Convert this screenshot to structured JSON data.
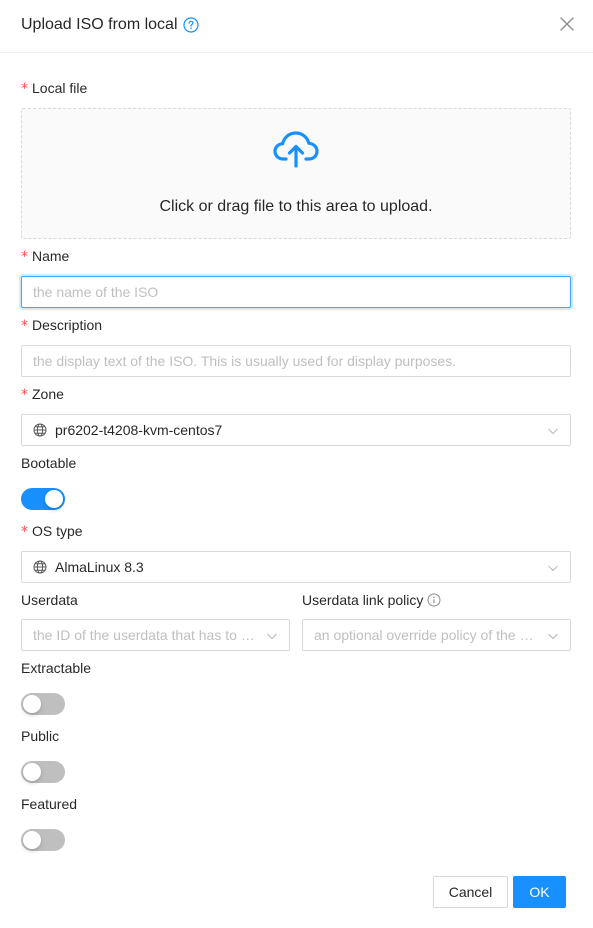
{
  "dialog": {
    "title": "Upload ISO from local"
  },
  "form": {
    "local_file": {
      "label": "Local file",
      "dropzone_text": "Click or drag file to this area to upload."
    },
    "name": {
      "label": "Name",
      "placeholder": "the name of the ISO",
      "value": ""
    },
    "description": {
      "label": "Description",
      "placeholder": "the display text of the ISO. This is usually used for display purposes.",
      "value": ""
    },
    "zone": {
      "label": "Zone",
      "value": "pr6202-t4208-kvm-centos7"
    },
    "bootable": {
      "label": "Bootable",
      "on": true
    },
    "os_type": {
      "label": "OS type",
      "value": "AlmaLinux 8.3"
    },
    "userdata": {
      "label": "Userdata",
      "placeholder": "the ID of the userdata that has to …"
    },
    "userdata_link_policy": {
      "label": "Userdata link policy",
      "placeholder": "an optional override policy of the …"
    },
    "extractable": {
      "label": "Extractable",
      "on": false
    },
    "public": {
      "label": "Public",
      "on": false
    },
    "featured": {
      "label": "Featured",
      "on": false
    }
  },
  "footer": {
    "cancel_label": "Cancel",
    "ok_label": "OK"
  },
  "colors": {
    "primary": "#1890ff",
    "required": "#ff4d4f",
    "border": "#d9d9d9"
  },
  "icons": {
    "help": "question-circle-icon",
    "close": "close-icon",
    "upload": "cloud-upload-icon",
    "zone": "globe-icon",
    "os": "globe-icon",
    "info": "info-circle-icon",
    "dropdown": "chevron-down-icon"
  }
}
